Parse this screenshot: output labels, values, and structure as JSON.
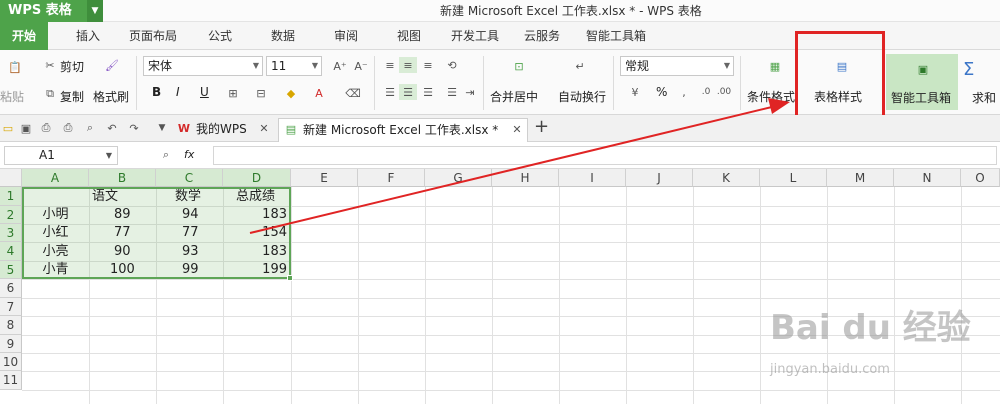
{
  "titlebar": {
    "app_label": "WPS 表格",
    "window_title": "新建 Microsoft Excel 工作表.xlsx * - WPS 表格"
  },
  "menu": {
    "tabs": [
      "开始",
      "插入",
      "页面布局",
      "公式",
      "数据",
      "审阅",
      "视图",
      "开发工具",
      "云服务",
      "智能工具箱"
    ]
  },
  "ribbon": {
    "paste": "粘贴",
    "cut": "剪切",
    "copy": "复制",
    "format_painter": "格式刷",
    "font_name": "宋体",
    "font_size": "11",
    "bold": "B",
    "italic": "I",
    "underline": "U",
    "merge_center": "合并居中",
    "wrap_text": "自动换行",
    "number_format": "常规",
    "percent": "%",
    "conditional_format": "条件格式",
    "table_style": "表格样式",
    "smart_toolbox": "智能工具箱",
    "sum": "求和",
    "sigma": "Σ"
  },
  "tabs": {
    "wps_tab": "我的WPS",
    "doc_tab": "新建 Microsoft Excel 工作表.xlsx *",
    "new_tab": "+"
  },
  "formula_bar": {
    "cell_ref": "A1",
    "fx": "fx",
    "value": ""
  },
  "sheet": {
    "columns": [
      "A",
      "B",
      "C",
      "D",
      "E",
      "F",
      "G",
      "H",
      "I",
      "J",
      "K",
      "L",
      "M",
      "N",
      "O"
    ],
    "rows": [
      "1",
      "2",
      "3",
      "4",
      "5",
      "6",
      "7",
      "8",
      "9",
      "10",
      "11"
    ],
    "headers": [
      "",
      "语文",
      "数学",
      "总成绩"
    ],
    "data": [
      [
        "小明",
        "89",
        "94",
        "183"
      ],
      [
        "小红",
        "77",
        "77",
        "154"
      ],
      [
        "小亮",
        "90",
        "93",
        "183"
      ],
      [
        "小青",
        "100",
        "99",
        "199"
      ]
    ]
  },
  "watermark": {
    "logo": "Bai du 经验",
    "url": "jingyan.baidu.com"
  },
  "colors": {
    "accent": "#4ea34a",
    "highlight": "#e02424",
    "selection": "#5ea557"
  }
}
